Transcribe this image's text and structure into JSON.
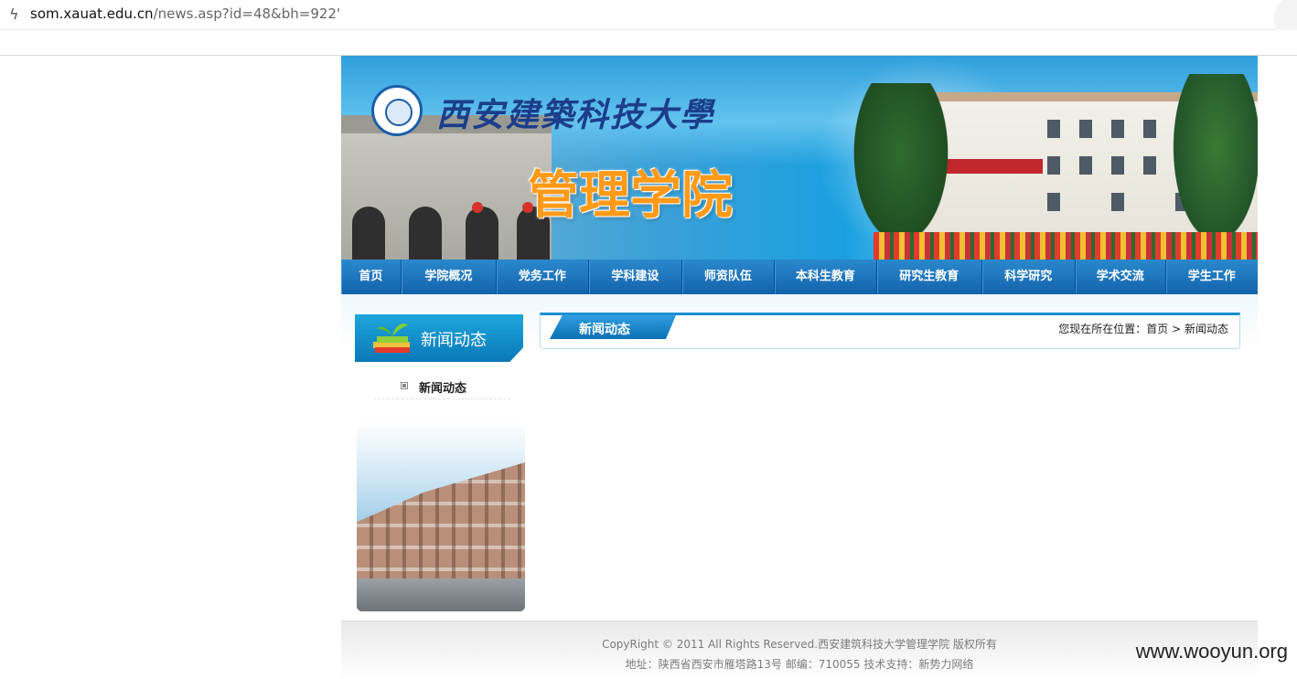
{
  "browser": {
    "url_host": "som.xauat.edu.cn",
    "url_path": "/news.asp?id=48&bh=922'"
  },
  "banner": {
    "university_name": "西安建築科技大學",
    "school_name": "管理学院"
  },
  "nav": {
    "items": [
      "首页",
      "学院概况",
      "党务工作",
      "学科建设",
      "师资队伍",
      "本科生教育",
      "研究生教育",
      "科学研究",
      "学术交流",
      "学生工作"
    ]
  },
  "sidebar": {
    "title": "新闻动态",
    "menu": [
      {
        "label": "新闻动态"
      }
    ]
  },
  "main": {
    "tab_title": "新闻动态",
    "breadcrumb_prefix": "您现在所在位置：",
    "breadcrumb_home": "首页",
    "breadcrumb_sep": ">",
    "breadcrumb_current": "新闻动态"
  },
  "footer": {
    "line1": "CopyRight © 2011 All Rights Reserved.西安建筑科技大学管理学院  版权所有",
    "line2": "地址：陕西省西安市雁塔路13号  邮编：710055  技术支持：新势力网络"
  },
  "watermark": "www.wooyun.org",
  "colors": {
    "nav_bg": "#1463ac",
    "accent_blue": "#1a8fd3",
    "school_name_orange": "#ff9a18"
  }
}
